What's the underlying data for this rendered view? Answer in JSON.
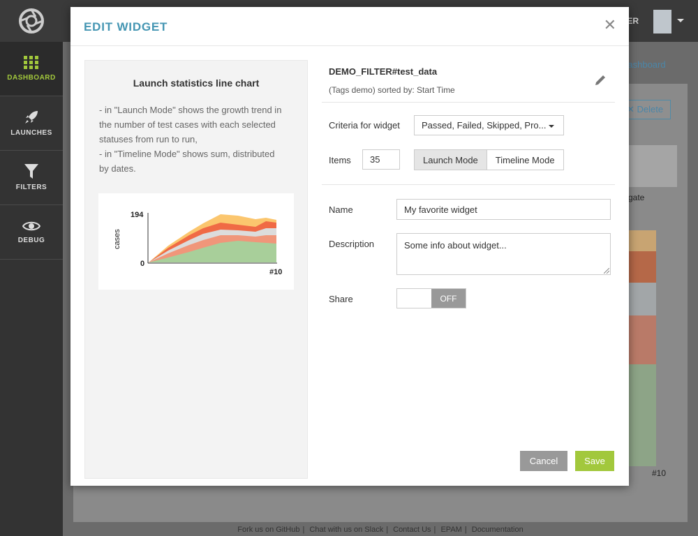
{
  "nav": {
    "items": [
      {
        "label": "DASHBOARD",
        "icon": "grid-icon"
      },
      {
        "label": "LAUNCHES",
        "icon": "rocket-icon"
      },
      {
        "label": "FILTERS",
        "icon": "filter-icon"
      },
      {
        "label": "DEBUG",
        "icon": "eye-icon"
      }
    ]
  },
  "topbar": {
    "user_text": "ER"
  },
  "background": {
    "dashboard_link": "Dashboard",
    "delete_button": "Delete",
    "chart_label": "gate",
    "chart_tick": "#10",
    "footer": [
      "Fork us on GitHub",
      "Chat with us on Slack",
      "Contact Us",
      "EPAM",
      "Documentation"
    ]
  },
  "modal": {
    "title": "EDIT WIDGET",
    "preview": {
      "title": "Launch statistics line chart",
      "description_lines": [
        "- in \"Launch Mode\" shows the growth trend in",
        "the number of test cases with each selected",
        "statuses from run to run,",
        "- in \"Timeline Mode\" shows sum, distributed",
        "by dates."
      ],
      "chart": {
        "y_max_label": "194",
        "y_min_label": "0",
        "y_axis_label": "cases",
        "x_label": "#10"
      }
    },
    "filter": {
      "name": "DEMO_FILTER#test_data",
      "sub": "(Tags demo) sorted by: Start Time"
    },
    "criteria": {
      "label": "Criteria for widget",
      "value": "Passed, Failed, Skipped, Pro..."
    },
    "items": {
      "label": "Items",
      "value": "35"
    },
    "mode": {
      "launch": "Launch Mode",
      "timeline": "Timeline Mode"
    },
    "name": {
      "label": "Name",
      "value": "My favorite widget"
    },
    "description": {
      "label": "Description",
      "value": "Some info about widget..."
    },
    "share": {
      "label": "Share",
      "state": "OFF"
    },
    "buttons": {
      "cancel": "Cancel",
      "save": "Save"
    }
  },
  "colors": {
    "accent": "#a2c83c",
    "title": "#4596b3",
    "passed": "#a8cf9a",
    "failed": "#f0967a",
    "skipped": "#dcdcdc",
    "product_bug": "#f06a45",
    "auto_bug": "#fbc66e"
  }
}
